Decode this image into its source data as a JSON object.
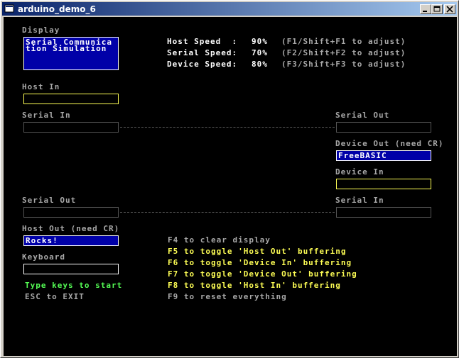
{
  "window": {
    "title": "arduino_demo_6"
  },
  "labels": {
    "display": "Display",
    "host_in": "Host In",
    "serial_in_left": "Serial In",
    "serial_out_right": "Serial Out",
    "device_out": "Device Out (need CR)",
    "device_in": "Device In",
    "serial_out_left": "Serial Out",
    "serial_in_right": "Serial In",
    "host_out": "Host Out (need CR)",
    "keyboard": "Keyboard"
  },
  "display_text": [
    "Serial Communica",
    "tion Simulation"
  ],
  "speeds": [
    {
      "label": "Host Speed  :",
      "value": "90%",
      "hint": "(F1/Shift+F1 to adjust)"
    },
    {
      "label": "Serial Speed:",
      "value": "70%",
      "hint": "(F2/Shift+F2 to adjust)"
    },
    {
      "label": "Device Speed:",
      "value": "80%",
      "hint": "(F3/Shift+F3 to adjust)"
    }
  ],
  "values": {
    "device_out": "FreeBASIC",
    "host_out": "Rocks!"
  },
  "messages": {
    "type_keys": "Type keys to start",
    "esc": "ESC to EXIT"
  },
  "help": [
    "F4 to clear display",
    "F5 to toggle 'Host Out' buffering",
    "F6 to toggle 'Device In' buffering",
    "F7 to toggle 'Device Out' buffering",
    "F8 to toggle 'Host In' buffering",
    "F9 to reset everything"
  ],
  "colors": {
    "background": "#000000",
    "label": "#a8a8a8",
    "highlight": "#fcfc54",
    "active": "#54fc54",
    "field_blue": "#0000a8"
  }
}
